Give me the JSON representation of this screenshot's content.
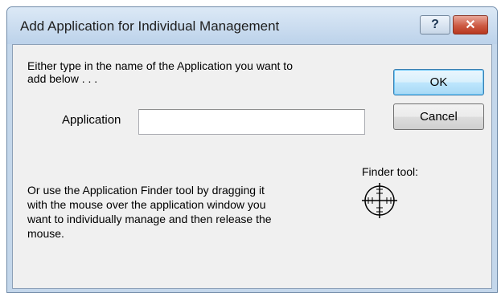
{
  "window": {
    "title": "Add Application for Individual Management",
    "help_glyph": "?",
    "close_glyph": "✕"
  },
  "dialog": {
    "instruction_line1": "Either type in the name of the Application you want to",
    "instruction_line2": "add below . . .",
    "application_label": "Application",
    "application_value": "",
    "ok_label": "OK",
    "cancel_label": "Cancel",
    "finder_label": "Finder tool:",
    "finder_icon": "crosshair-icon",
    "finder_instructions": [
      "Or use the Application Finder tool by dragging it",
      "with the mouse over the application window you",
      "want to individually manage and then release the",
      "mouse."
    ]
  }
}
